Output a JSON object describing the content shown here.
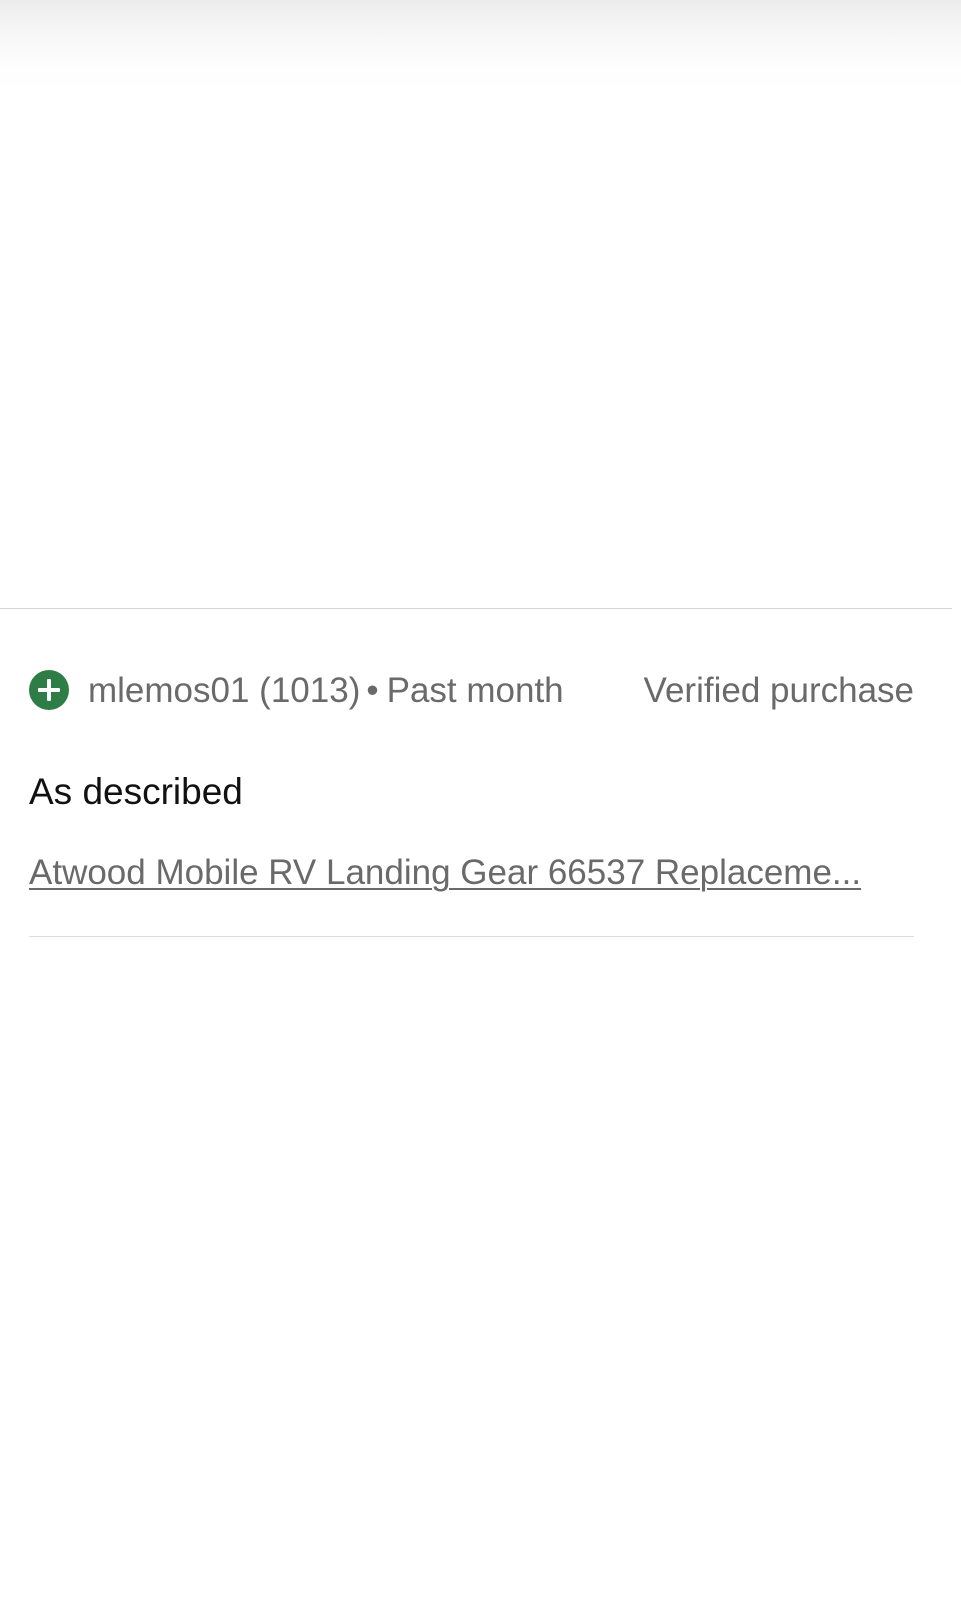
{
  "feedback": {
    "rating_icon": "plus-circle-icon",
    "rating_color": "#2e7d46",
    "reviewer": "mlemos01 (1013)",
    "separator": "•",
    "time": "Past month",
    "verified": "Verified purchase",
    "comment": "As described",
    "item_title": "Atwood Mobile RV Landing Gear 66537 Replaceme..."
  }
}
